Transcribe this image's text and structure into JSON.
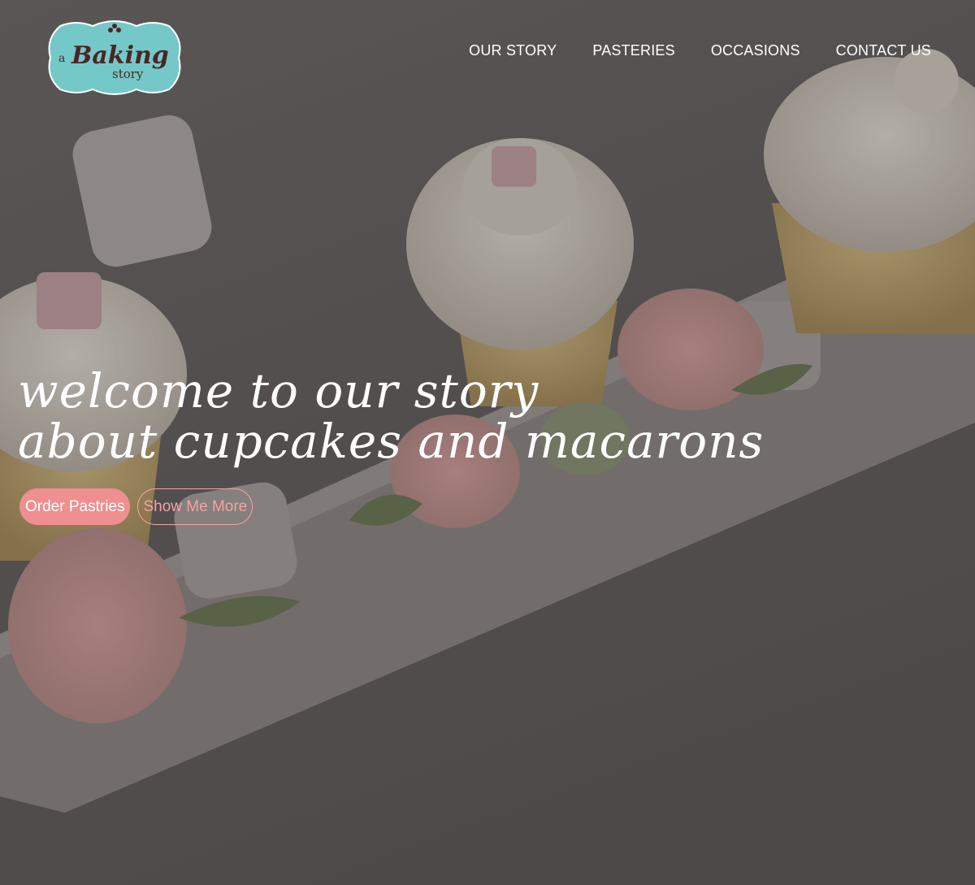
{
  "brand": {
    "logo_prefix": "a",
    "logo_main": "Baking",
    "logo_suffix": "story",
    "logo_color": "#74c9c8"
  },
  "nav": {
    "items": [
      {
        "label": "OUR STORY"
      },
      {
        "label": "PASTERIES"
      },
      {
        "label": "OCCASIONS"
      },
      {
        "label": "CONTACT US"
      }
    ]
  },
  "hero": {
    "headline_line1": "welcome to our story",
    "headline_line2": "about cupcakes and macarons",
    "primary_button": "Order Pastries",
    "secondary_button": "Show Me More",
    "accent_color": "#ef8f8f"
  }
}
